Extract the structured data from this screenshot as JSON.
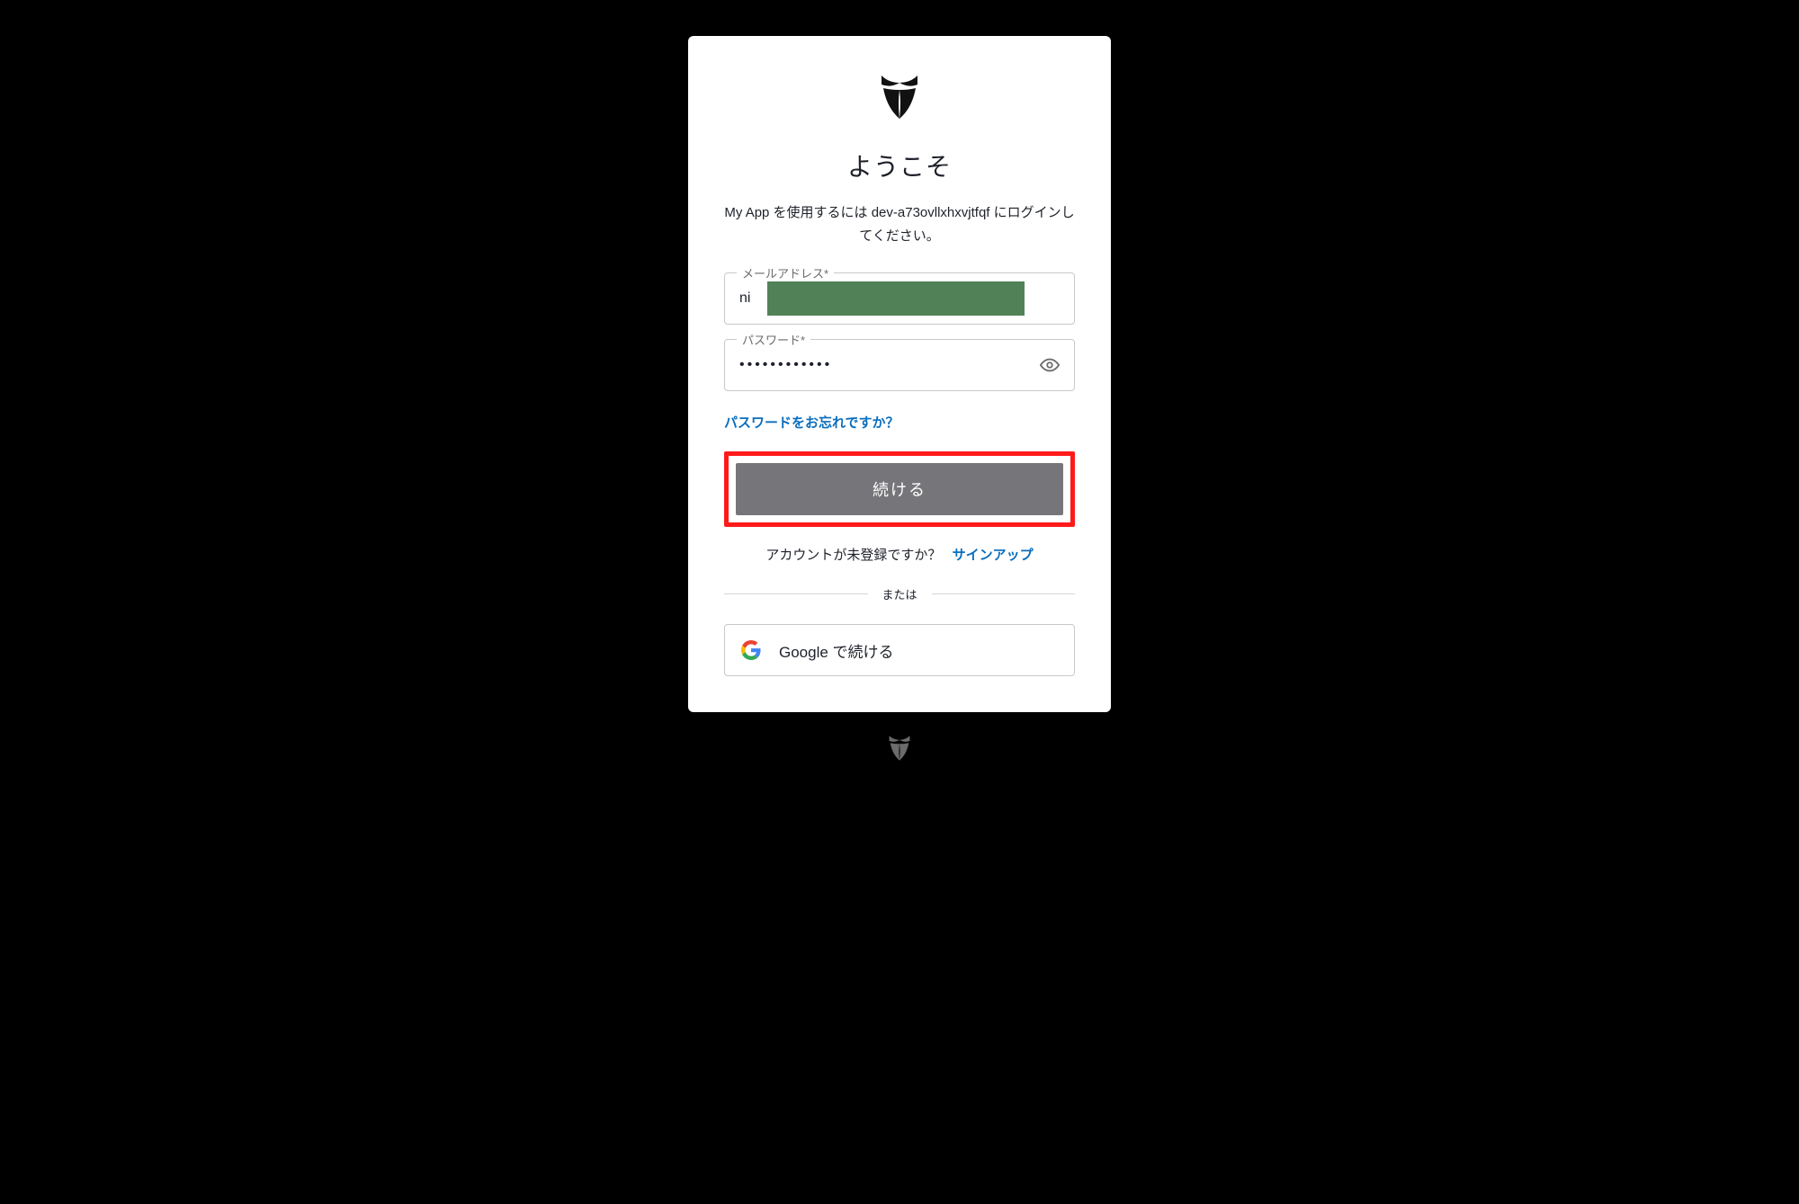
{
  "headline": "ようこそ",
  "subtitle": "My App を使用するには dev-a73ovllxhxvjtfqf にログインしてください。",
  "email": {
    "label": "メールアドレス*",
    "value": "ni"
  },
  "password": {
    "label": "パスワード*",
    "value": "••••••••••••"
  },
  "forgot": "パスワードをお忘れですか？",
  "continue": "続ける",
  "signup_prompt": "アカウントが未登録ですか？",
  "signup_link": "サインアップ",
  "divider": "または",
  "google": "Google で続ける",
  "colors": {
    "link": "#0a6ebd",
    "highlight_border": "#ff1a1a",
    "redaction": "#518257",
    "button_bg": "#76767a"
  }
}
